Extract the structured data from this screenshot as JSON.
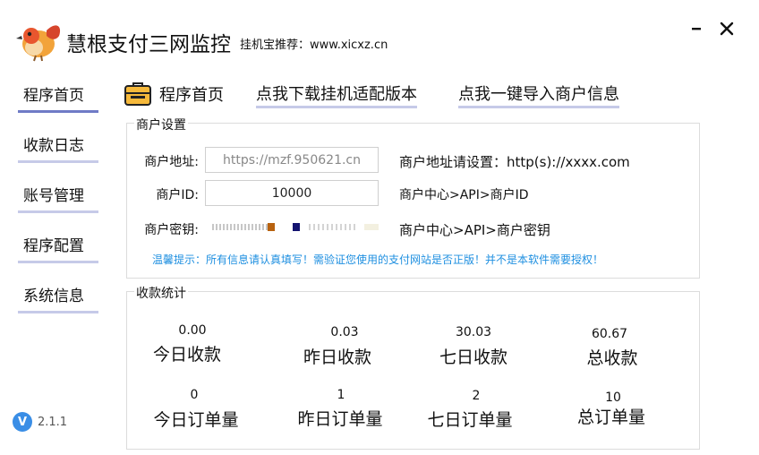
{
  "header": {
    "title": "慧根支付三网监控",
    "subtitle": "挂机宝推荐：www.xicxz.cn",
    "minimize_label": "minimize",
    "close_label": "close"
  },
  "sidebar": {
    "items": [
      {
        "label": "程序首页",
        "active": true
      },
      {
        "label": "收款日志",
        "active": false
      },
      {
        "label": "账号管理",
        "active": false
      },
      {
        "label": "程序配置",
        "active": false
      },
      {
        "label": "系统信息",
        "active": false
      }
    ]
  },
  "version": {
    "badge": "V",
    "text": "2.1.1"
  },
  "nav": {
    "home_label": "程序首页",
    "download_label": "点我下载挂机适配版本",
    "import_label": "点我一键导入商户信息"
  },
  "merchant": {
    "group_title": "商户设置",
    "address_label": "商户地址:",
    "address_value": "https://mzf.950621.cn",
    "address_hint": "商户地址请设置：http(s)://xxxx.com",
    "id_label": "商户ID:",
    "id_value": "10000",
    "id_hint": "商户中心>API>商户ID",
    "key_label": "商户密钥:",
    "key_hint": "商户中心>API>商户密钥",
    "tip": "温馨提示：所有信息请认真填写！需验证您使用的支付网站是否正版！并不是本软件需要授权！"
  },
  "stats": {
    "group_title": "收款统计",
    "items": [
      {
        "value": "0.00",
        "label": "今日收款"
      },
      {
        "value": "0.03",
        "label": "昨日收款"
      },
      {
        "value": "30.03",
        "label": "七日收款"
      },
      {
        "value": "60.67",
        "label": "总收款"
      },
      {
        "value": "0",
        "label": "今日订单量"
      },
      {
        "value": "1",
        "label": "昨日订单量"
      },
      {
        "value": "2",
        "label": "七日订单量"
      },
      {
        "value": "10",
        "label": "总订单量"
      }
    ]
  },
  "colors": {
    "accent": "#6f7bc6",
    "underline": "#c6cae8",
    "tip": "#1e8fe0",
    "version_badge": "#3a8ee6"
  },
  "icons": {
    "logo": "bird-logo-icon",
    "nav_home": "briefcase-icon",
    "minimize": "minimize-icon",
    "close": "close-icon"
  }
}
